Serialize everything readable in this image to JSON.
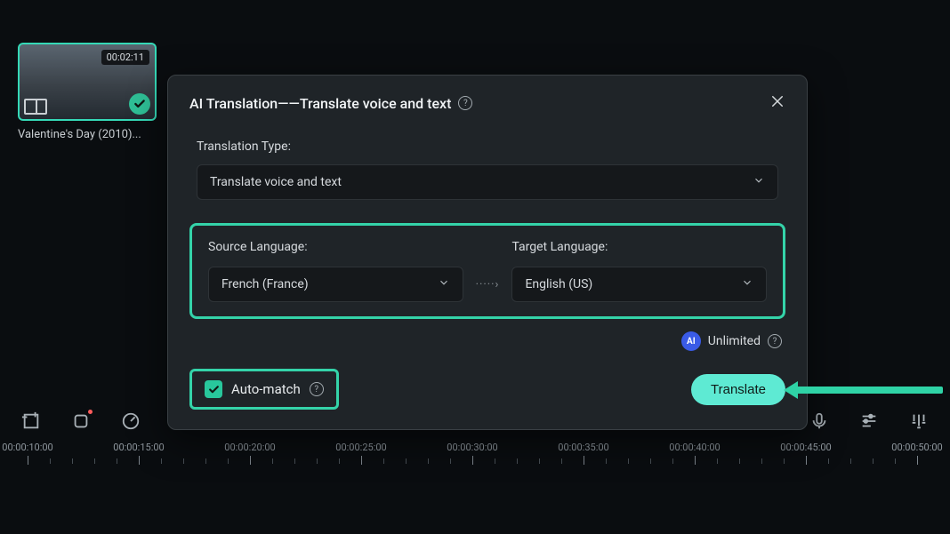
{
  "media": {
    "clip": {
      "duration": "00:02:11",
      "label": "Valentine's Day (2010)..."
    }
  },
  "timeline": {
    "labels": [
      "00:00:10:00",
      "00:00:15:00",
      "00:00:20:00",
      "00:00:25:00",
      "00:00:30:00",
      "00:00:35:00",
      "00:00:40:00",
      "00:00:45:00",
      "00:00:50:00"
    ]
  },
  "modal": {
    "title": "AI Translation——Translate voice and text",
    "type_label": "Translation Type:",
    "type_value": "Translate voice and text",
    "source_label": "Source Language:",
    "source_value": "French (France)",
    "target_label": "Target Language:",
    "target_value": "English (US)",
    "status_text": "Unlimited",
    "auto_label": "Auto-match",
    "translate_label": "Translate"
  }
}
